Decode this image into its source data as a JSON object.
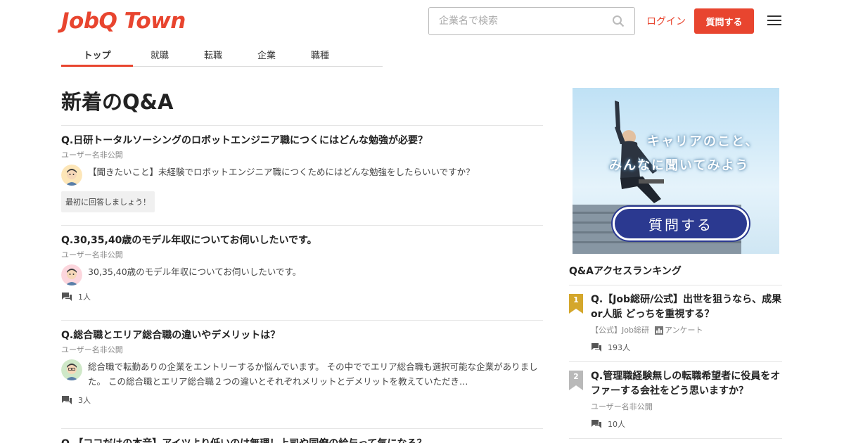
{
  "header": {
    "logo": "JobQ Town",
    "search_placeholder": "企業名で検索",
    "login_label": "ログイン",
    "ask_label": "質問する"
  },
  "tabs": [
    {
      "label": "トップ",
      "active": true
    },
    {
      "label": "就職"
    },
    {
      "label": "転職"
    },
    {
      "label": "企業"
    },
    {
      "label": "職種"
    }
  ],
  "main": {
    "title": "新着のQ&A",
    "questions": [
      {
        "title": "Q.日研トータルソーシングのロボットエンジニア職につくにはどんな勉強が必要？",
        "user": "ユーザー名非公開",
        "text": "【聞きたいこと】未経験でロボットエンジニア職につくためにはどんな勉強をしたらいいですか？",
        "first_answer": "最初に回答しましょう！"
      },
      {
        "title": "Q.30,35,40歳のモデル年収についてお伺いしたいです。",
        "user": "ユーザー名非公開",
        "text": "30,35,40歳のモデル年収についてお伺いしたいです。",
        "count": "1人"
      },
      {
        "title": "Q.総合職とエリア総合職の違いやデメリットは？",
        "user": "ユーザー名非公開",
        "text": "総合職で転勤ありの企業をエントリーするか悩んでいます。 その中ででエリア総合職も選択可能な企業がありました。 この総合職とエリア総合職２つの違いとそれぞれメリットとデメリットを教えていただき…",
        "count": "3人"
      },
      {
        "title": "Q.【ココだけの本音】アイツより低いのは無理！上司や同僚の給与って気になる？"
      }
    ]
  },
  "banner": {
    "line1": "キャリアのこと、",
    "line2": "みんなに聞いてみよう",
    "button": "質問する"
  },
  "ranking": {
    "title": "Q&Aアクセスランキング",
    "items": [
      {
        "rank": "1",
        "color": "#d4a72c",
        "question": "Q.【Job総研/公式】出世を狙うなら、成果or人脈 どっちを重視する？",
        "author": "【公式】Job総研",
        "tag": "アンケート",
        "count": "193人"
      },
      {
        "rank": "2",
        "color": "#b9b9b9",
        "question": "Q.管理職経験無しの転職希望者に役員をオファーする会社をどう思いますか？",
        "author": "ユーザー名非公開",
        "count": "10人"
      }
    ]
  },
  "colors": {
    "accent": "#e8452f",
    "banner_button": "#2b3990"
  }
}
